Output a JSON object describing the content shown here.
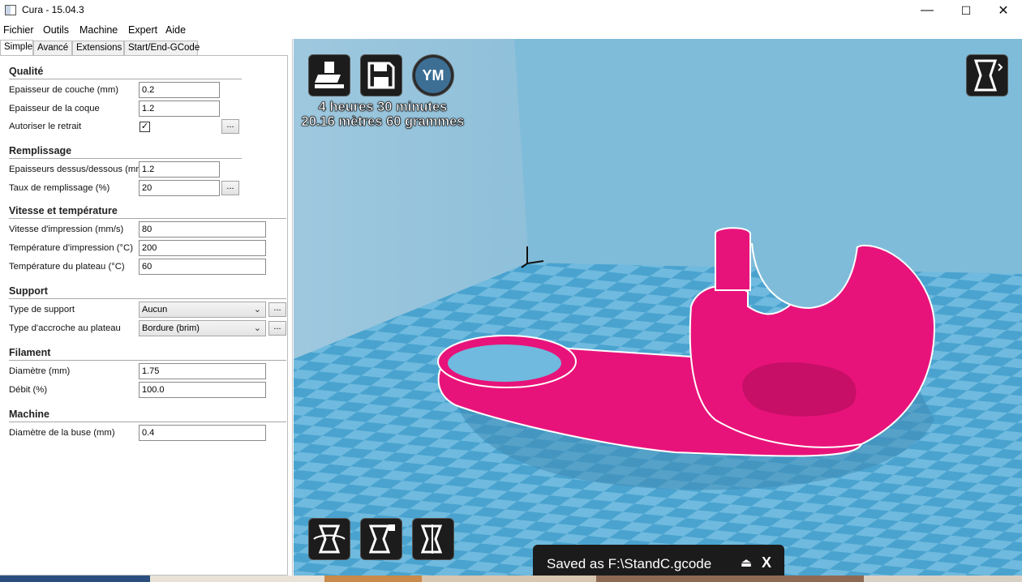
{
  "window": {
    "title": "Cura - 15.04.3",
    "minimize": "—",
    "maximize": "☐",
    "close": "✕"
  },
  "menu": [
    "Fichier",
    "Outils",
    "Machine",
    "Expert",
    "Aide"
  ],
  "tabs": [
    "Simple",
    "Avancé",
    "Extensions",
    "Start/End-GCode"
  ],
  "sections": {
    "qualite": {
      "title": "Qualité",
      "couche_label": "Epaisseur de couche (mm)",
      "couche_value": "0.2",
      "coque_label": "Epaisseur de la coque",
      "coque_value": "1.2",
      "retrait_label": "Autoriser le retrait",
      "retrait_checked": "✓"
    },
    "remplissage": {
      "title": "Remplissage",
      "dessus_label": "Epaisseurs dessus/dessous (mm)",
      "dessus_value": "1.2",
      "taux_label": "Taux de remplissage (%)",
      "taux_value": "20"
    },
    "vitesse": {
      "title": "Vitesse et température",
      "vitesse_label": "Vitesse d'impression (mm/s)",
      "vitesse_value": "80",
      "temp_label": "Température d'impression (°C)",
      "temp_value": "200",
      "plateau_label": "Température du plateau (°C)",
      "plateau_value": "60"
    },
    "support": {
      "title": "Support",
      "type_label": "Type de support",
      "type_value": "Aucun",
      "accroche_label": "Type d'accroche au plateau",
      "accroche_value": "Bordure (brim)"
    },
    "filament": {
      "title": "Filament",
      "diametre_label": "Diamètre (mm)",
      "diametre_value": "1.75",
      "debit_label": "Débit (%)",
      "debit_value": "100.0"
    },
    "machine": {
      "title": "Machine",
      "buse_label": "Diamètre de la buse (mm)",
      "buse_value": "0.4"
    }
  },
  "dots_label": "...",
  "viewport": {
    "print_time": "4 heures 30 minutes",
    "print_stats": "20.16 mètres 60 grammes",
    "ym_label": "YM",
    "toast_text": "Saved as F:\\StandC.gcode",
    "toast_close": "X"
  },
  "colors": {
    "model": "#e8137a",
    "plate": "#5ba9d0",
    "viewport_bg": "#7fb8d3"
  }
}
